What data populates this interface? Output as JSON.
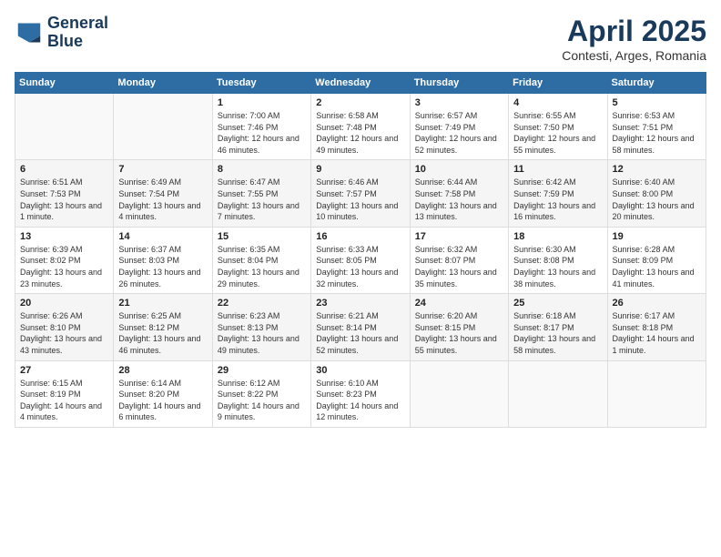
{
  "logo": {
    "line1": "General",
    "line2": "Blue"
  },
  "title": "April 2025",
  "subtitle": "Contesti, Arges, Romania",
  "weekdays": [
    "Sunday",
    "Monday",
    "Tuesday",
    "Wednesday",
    "Thursday",
    "Friday",
    "Saturday"
  ],
  "weeks": [
    [
      {
        "day": "",
        "empty": true
      },
      {
        "day": "",
        "empty": true
      },
      {
        "day": "1",
        "sunrise": "Sunrise: 7:00 AM",
        "sunset": "Sunset: 7:46 PM",
        "daylight": "Daylight: 12 hours and 46 minutes."
      },
      {
        "day": "2",
        "sunrise": "Sunrise: 6:58 AM",
        "sunset": "Sunset: 7:48 PM",
        "daylight": "Daylight: 12 hours and 49 minutes."
      },
      {
        "day": "3",
        "sunrise": "Sunrise: 6:57 AM",
        "sunset": "Sunset: 7:49 PM",
        "daylight": "Daylight: 12 hours and 52 minutes."
      },
      {
        "day": "4",
        "sunrise": "Sunrise: 6:55 AM",
        "sunset": "Sunset: 7:50 PM",
        "daylight": "Daylight: 12 hours and 55 minutes."
      },
      {
        "day": "5",
        "sunrise": "Sunrise: 6:53 AM",
        "sunset": "Sunset: 7:51 PM",
        "daylight": "Daylight: 12 hours and 58 minutes."
      }
    ],
    [
      {
        "day": "6",
        "sunrise": "Sunrise: 6:51 AM",
        "sunset": "Sunset: 7:53 PM",
        "daylight": "Daylight: 13 hours and 1 minute."
      },
      {
        "day": "7",
        "sunrise": "Sunrise: 6:49 AM",
        "sunset": "Sunset: 7:54 PM",
        "daylight": "Daylight: 13 hours and 4 minutes."
      },
      {
        "day": "8",
        "sunrise": "Sunrise: 6:47 AM",
        "sunset": "Sunset: 7:55 PM",
        "daylight": "Daylight: 13 hours and 7 minutes."
      },
      {
        "day": "9",
        "sunrise": "Sunrise: 6:46 AM",
        "sunset": "Sunset: 7:57 PM",
        "daylight": "Daylight: 13 hours and 10 minutes."
      },
      {
        "day": "10",
        "sunrise": "Sunrise: 6:44 AM",
        "sunset": "Sunset: 7:58 PM",
        "daylight": "Daylight: 13 hours and 13 minutes."
      },
      {
        "day": "11",
        "sunrise": "Sunrise: 6:42 AM",
        "sunset": "Sunset: 7:59 PM",
        "daylight": "Daylight: 13 hours and 16 minutes."
      },
      {
        "day": "12",
        "sunrise": "Sunrise: 6:40 AM",
        "sunset": "Sunset: 8:00 PM",
        "daylight": "Daylight: 13 hours and 20 minutes."
      }
    ],
    [
      {
        "day": "13",
        "sunrise": "Sunrise: 6:39 AM",
        "sunset": "Sunset: 8:02 PM",
        "daylight": "Daylight: 13 hours and 23 minutes."
      },
      {
        "day": "14",
        "sunrise": "Sunrise: 6:37 AM",
        "sunset": "Sunset: 8:03 PM",
        "daylight": "Daylight: 13 hours and 26 minutes."
      },
      {
        "day": "15",
        "sunrise": "Sunrise: 6:35 AM",
        "sunset": "Sunset: 8:04 PM",
        "daylight": "Daylight: 13 hours and 29 minutes."
      },
      {
        "day": "16",
        "sunrise": "Sunrise: 6:33 AM",
        "sunset": "Sunset: 8:05 PM",
        "daylight": "Daylight: 13 hours and 32 minutes."
      },
      {
        "day": "17",
        "sunrise": "Sunrise: 6:32 AM",
        "sunset": "Sunset: 8:07 PM",
        "daylight": "Daylight: 13 hours and 35 minutes."
      },
      {
        "day": "18",
        "sunrise": "Sunrise: 6:30 AM",
        "sunset": "Sunset: 8:08 PM",
        "daylight": "Daylight: 13 hours and 38 minutes."
      },
      {
        "day": "19",
        "sunrise": "Sunrise: 6:28 AM",
        "sunset": "Sunset: 8:09 PM",
        "daylight": "Daylight: 13 hours and 41 minutes."
      }
    ],
    [
      {
        "day": "20",
        "sunrise": "Sunrise: 6:26 AM",
        "sunset": "Sunset: 8:10 PM",
        "daylight": "Daylight: 13 hours and 43 minutes."
      },
      {
        "day": "21",
        "sunrise": "Sunrise: 6:25 AM",
        "sunset": "Sunset: 8:12 PM",
        "daylight": "Daylight: 13 hours and 46 minutes."
      },
      {
        "day": "22",
        "sunrise": "Sunrise: 6:23 AM",
        "sunset": "Sunset: 8:13 PM",
        "daylight": "Daylight: 13 hours and 49 minutes."
      },
      {
        "day": "23",
        "sunrise": "Sunrise: 6:21 AM",
        "sunset": "Sunset: 8:14 PM",
        "daylight": "Daylight: 13 hours and 52 minutes."
      },
      {
        "day": "24",
        "sunrise": "Sunrise: 6:20 AM",
        "sunset": "Sunset: 8:15 PM",
        "daylight": "Daylight: 13 hours and 55 minutes."
      },
      {
        "day": "25",
        "sunrise": "Sunrise: 6:18 AM",
        "sunset": "Sunset: 8:17 PM",
        "daylight": "Daylight: 13 hours and 58 minutes."
      },
      {
        "day": "26",
        "sunrise": "Sunrise: 6:17 AM",
        "sunset": "Sunset: 8:18 PM",
        "daylight": "Daylight: 14 hours and 1 minute."
      }
    ],
    [
      {
        "day": "27",
        "sunrise": "Sunrise: 6:15 AM",
        "sunset": "Sunset: 8:19 PM",
        "daylight": "Daylight: 14 hours and 4 minutes."
      },
      {
        "day": "28",
        "sunrise": "Sunrise: 6:14 AM",
        "sunset": "Sunset: 8:20 PM",
        "daylight": "Daylight: 14 hours and 6 minutes."
      },
      {
        "day": "29",
        "sunrise": "Sunrise: 6:12 AM",
        "sunset": "Sunset: 8:22 PM",
        "daylight": "Daylight: 14 hours and 9 minutes."
      },
      {
        "day": "30",
        "sunrise": "Sunrise: 6:10 AM",
        "sunset": "Sunset: 8:23 PM",
        "daylight": "Daylight: 14 hours and 12 minutes."
      },
      {
        "day": "",
        "empty": true
      },
      {
        "day": "",
        "empty": true
      },
      {
        "day": "",
        "empty": true
      }
    ]
  ]
}
